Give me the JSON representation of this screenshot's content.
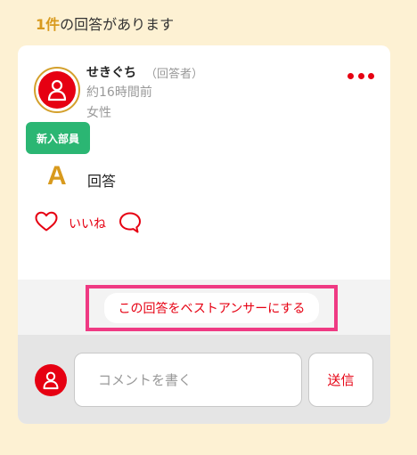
{
  "header": {
    "count": "1件",
    "suffix": "の回答があります"
  },
  "answer": {
    "user_name": "せきぐち",
    "user_role": "（回答者）",
    "time": "約16時間前",
    "gender": "女性",
    "badge": "新入部員",
    "letter": "A",
    "text": "回答",
    "like_label": "いいね",
    "icons": {
      "avatar": "user-icon",
      "more": "more-dots-icon",
      "like": "heart-icon",
      "comment": "speech-bubble-icon"
    }
  },
  "best_answer": {
    "label": "この回答をベストアンサーにする"
  },
  "comment_form": {
    "placeholder": "コメントを書く",
    "value": "",
    "send_label": "送信"
  },
  "colors": {
    "page_bg": "#fdf1d3",
    "accent_red": "#e60012",
    "gold": "#d89a1e",
    "badge_green": "#2bb673",
    "highlight_pink": "#ef3a83"
  }
}
